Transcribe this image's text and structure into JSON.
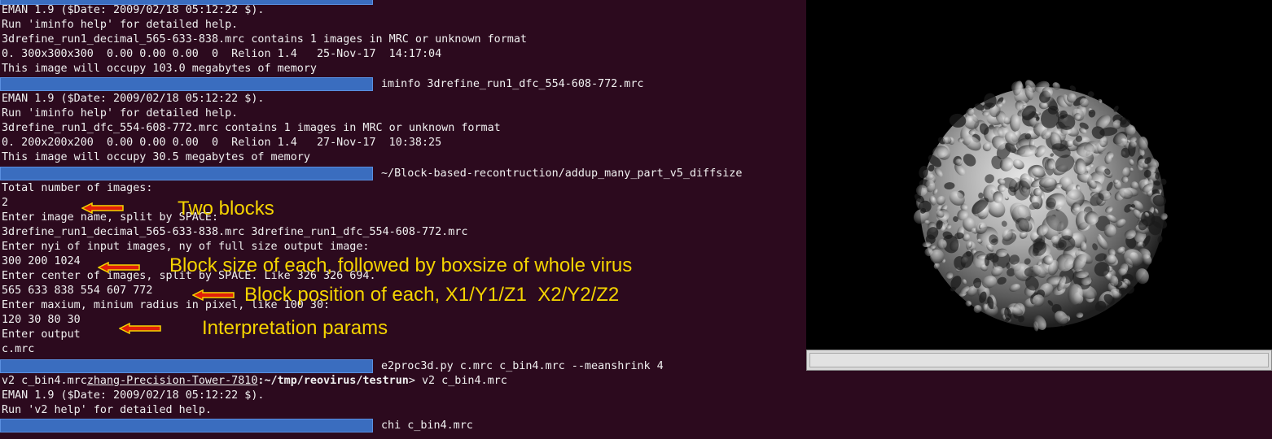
{
  "terminal": {
    "lines": [
      "EMAN 1.9 ($Date: 2009/02/18 05:12:22 $).",
      "Run 'iminfo help' for detailed help.",
      "3drefine_run1_decimal_565-633-838.mrc contains 1 images in MRC or unknown format",
      "0. 300x300x300  0.00 0.00 0.00  0  Relion 1.4   25-Nov-17  14:17:04",
      "This image will occupy 103.0 megabytes of memory",
      "",
      "EMAN 1.9 ($Date: 2009/02/18 05:12:22 $).",
      "Run 'iminfo help' for detailed help.",
      "3drefine_run1_dfc_554-608-772.mrc contains 1 images in MRC or unknown format",
      "0. 200x200x200  0.00 0.00 0.00  0  Relion 1.4   27-Nov-17  10:38:25",
      "This image will occupy 30.5 megabytes of memory",
      "",
      "Total number of images:",
      "2",
      "Enter image name, split by SPACE:",
      "3drefine_run1_decimal_565-633-838.mrc 3drefine_run1_dfc_554-608-772.mrc",
      "Enter nyi of input images, ny of full size output image:",
      "300 200 1024",
      "Enter center of images, split by SPACE. Like 326 326 694.",
      "565 633 838 554 607 772",
      "Enter maxium, minium radius in pixel, like 100 30:",
      "120 30 80 30",
      "Enter output",
      "c.mrc",
      "",
      "",
      "EMAN 1.9 ($Date: 2009/02/18 05:12:22 $).",
      "Run 'v2 help' for detailed help.",
      ""
    ],
    "prompt_line_prefix": "v2 c_bin4.mrc",
    "prompt_host": "zhang-Precision-Tower-7810",
    "prompt_path": ":~/tmp/reovirus/testrun",
    "prompt_command": "> v2 c_bin4.mrc",
    "commands": [
      "iminfo 3drefine_run1_dfc_554-608-772.mrc",
      "~/Block-based-recontruction/addup_many_part_v5_diffsize",
      "e2proc3d.py c.mrc c_bin4.mrc --meanshrink 4",
      "chi c_bin4.mrc"
    ]
  },
  "annotations": {
    "two_blocks": "Two blocks",
    "block_size": "Block size of each, followed by boxsize of whole virus",
    "block_position": "Block position of each, X1/Y1/Z1  X2/Y2/Z2",
    "interp_params": "Interpretation params"
  },
  "colors": {
    "terminal_bg": "#2c0a1e",
    "redaction": "#3a6dbf",
    "annotation_text": "#f5d400",
    "arrow_fill": "#e0200a",
    "arrow_outline": "#f5d400",
    "viewer_bg": "#000000"
  },
  "viewer": {
    "content": "3D rendered virus density map (grey isosurface)"
  }
}
